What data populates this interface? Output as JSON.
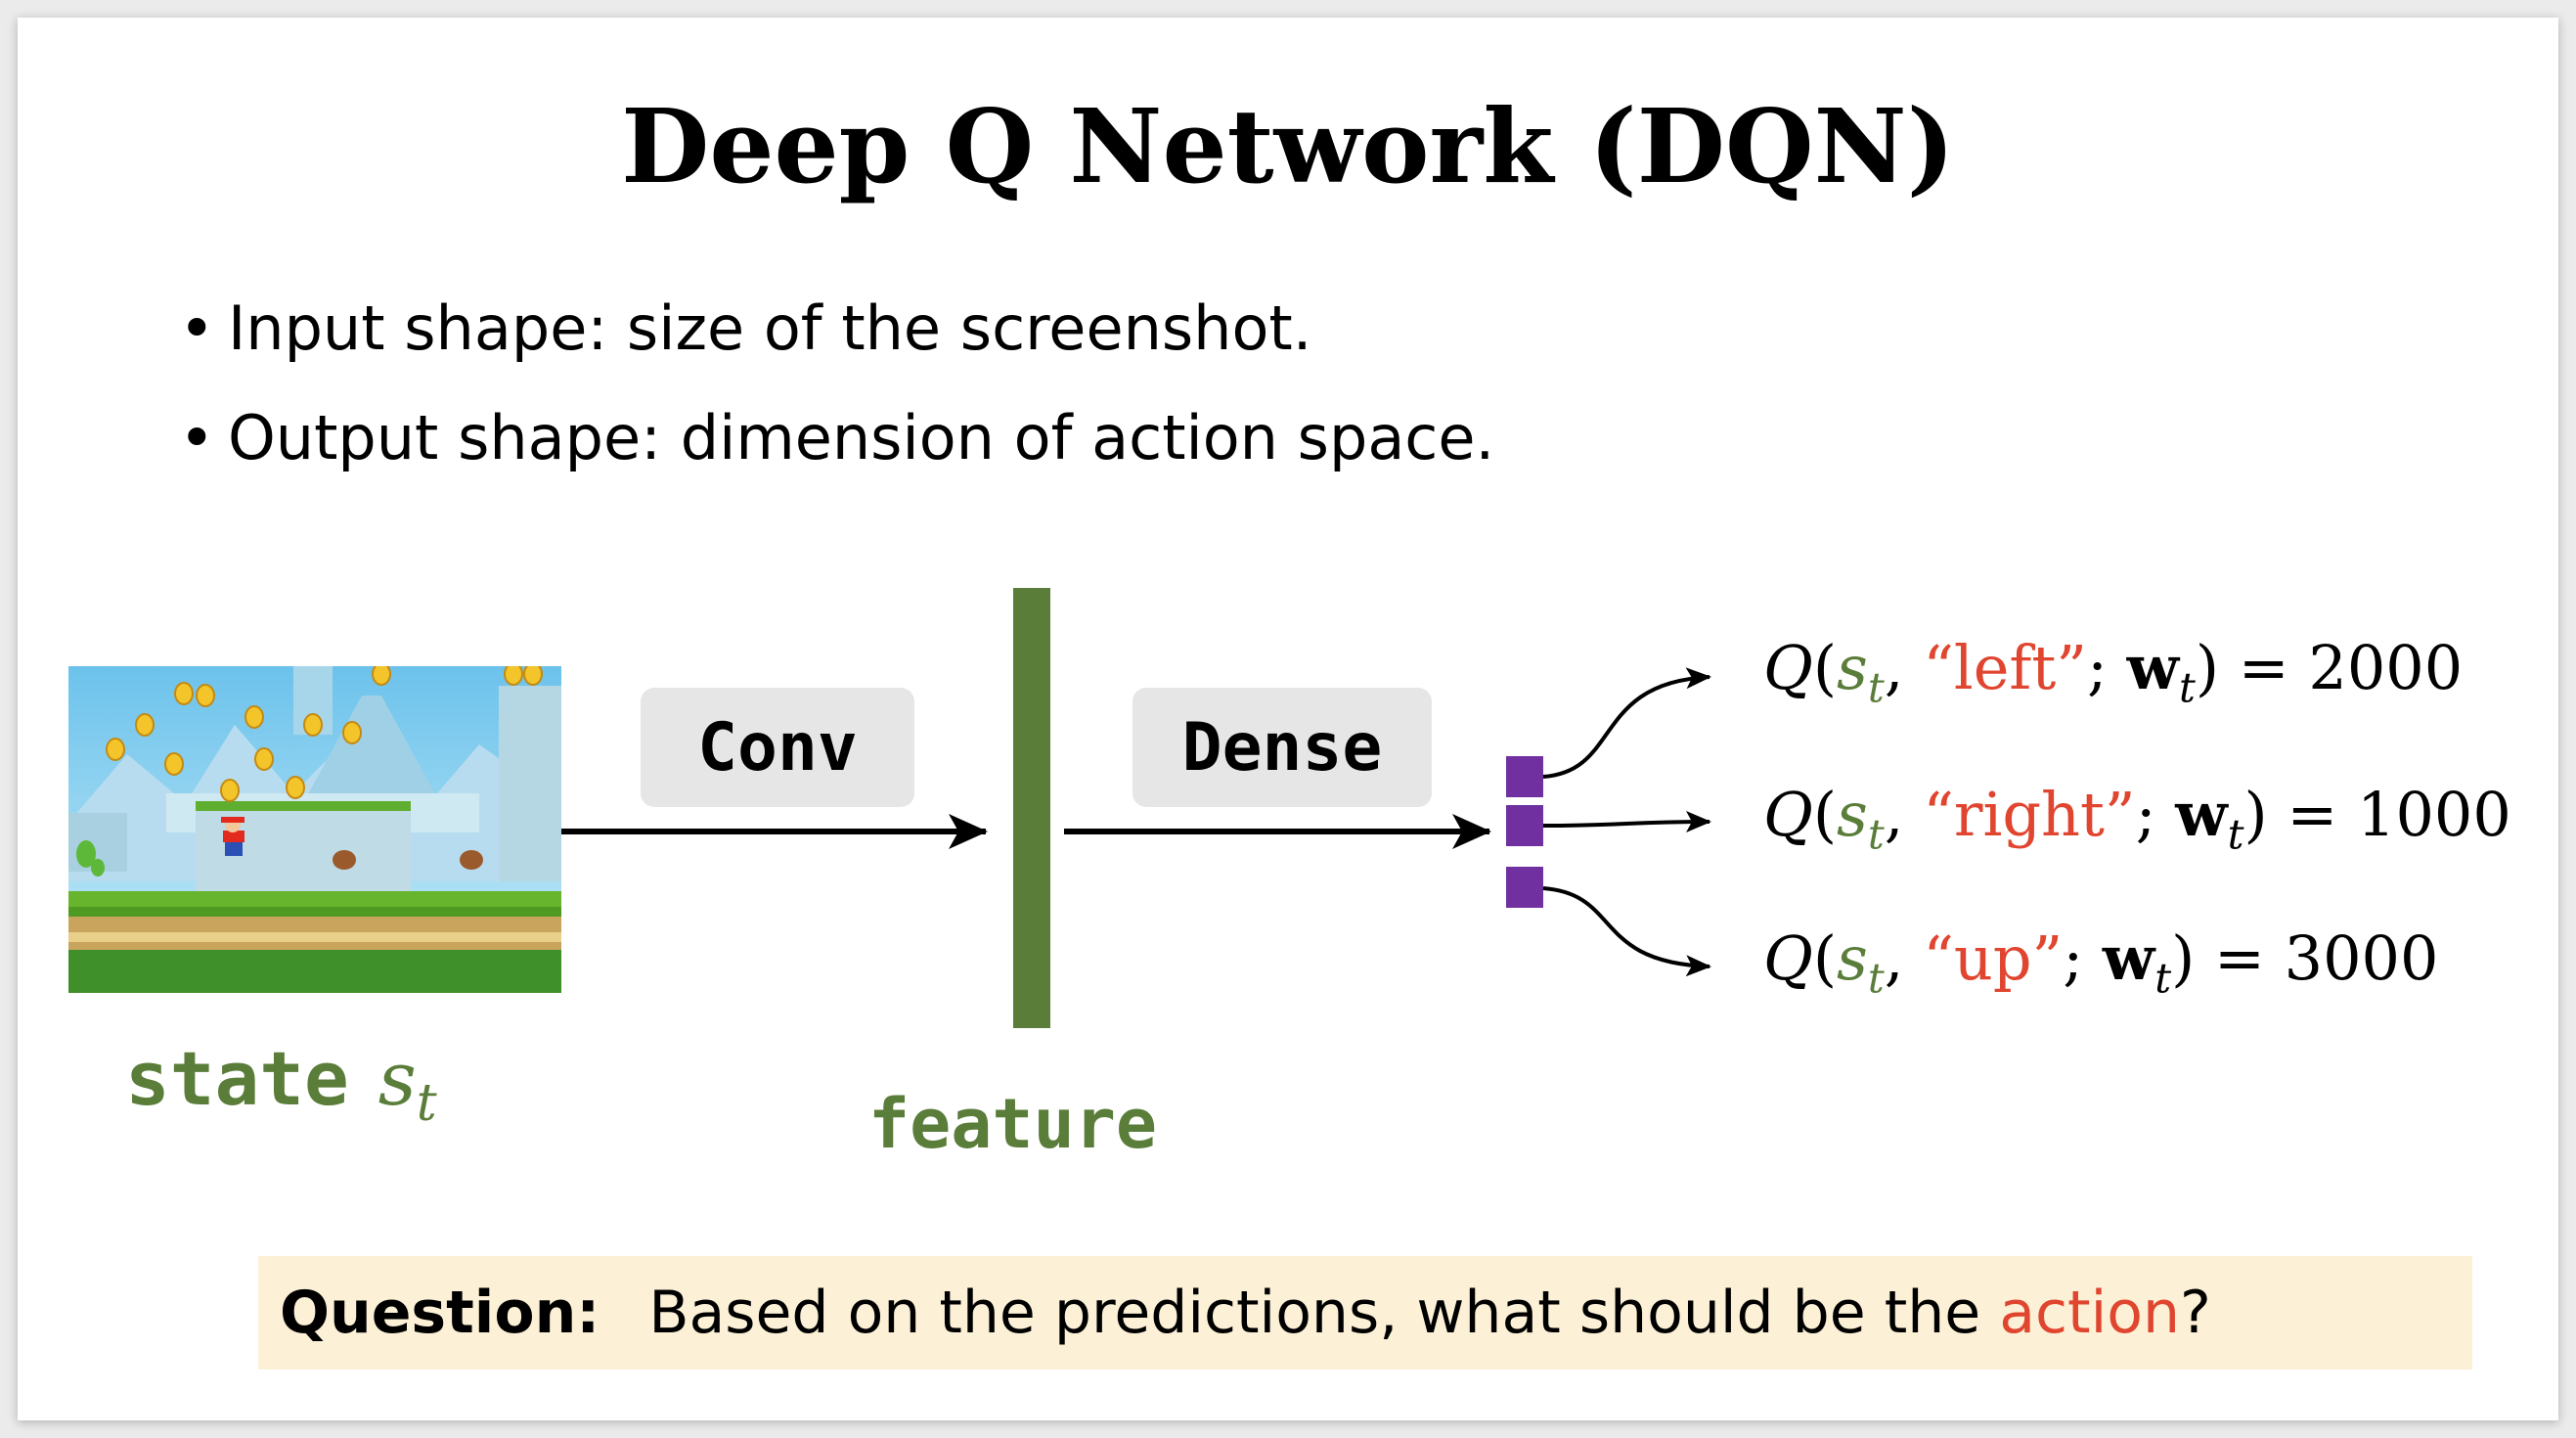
{
  "title": "Deep Q Network (DQN)",
  "bullets": [
    "Input shape: size of the screenshot.",
    "Output shape:  dimension of action space."
  ],
  "bullet_symbol": "•",
  "state": {
    "word": "state",
    "var": "s",
    "sub": "t"
  },
  "ops": {
    "conv": "Conv",
    "dense": "Dense"
  },
  "feature_label": "feature",
  "q_values": [
    {
      "Q": "Q",
      "s": "s",
      "s_sub": "t",
      "action": "“left”",
      "w": "w",
      "w_sub": "t",
      "value": "2000"
    },
    {
      "Q": "Q",
      "s": "s",
      "s_sub": "t",
      "action": "“right”",
      "w": "w",
      "w_sub": "t",
      "value": "1000"
    },
    {
      "Q": "Q",
      "s": "s",
      "s_sub": "t",
      "action": "“up”",
      "w": "w",
      "w_sub": "t",
      "value": "3000"
    }
  ],
  "question": {
    "label": "Question:",
    "text_before": "Based on the predictions, what should be the ",
    "highlight": "action",
    "text_after": "?"
  },
  "colors": {
    "green": "#5a7d3a",
    "red": "#e0452f",
    "purple": "#7030a0",
    "question_bg": "#fcf1d6",
    "box_bg": "#e6e6e6"
  }
}
